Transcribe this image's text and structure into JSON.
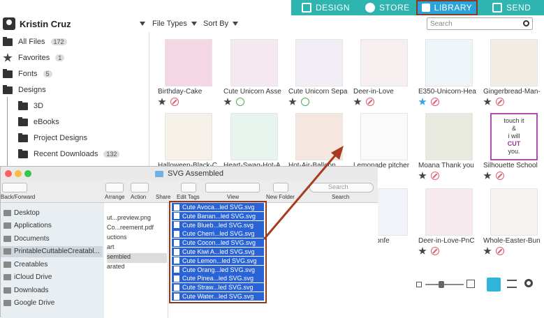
{
  "nav": {
    "design": "DESIGN",
    "store": "STORE",
    "library": "LIBRARY",
    "send": "SEND"
  },
  "user": {
    "name": "Kristin Cruz"
  },
  "toolbar": {
    "file_types": "File Types",
    "sort_by": "Sort By",
    "search_placeholder": "Search"
  },
  "sidebar": {
    "all_files": "All Files",
    "all_files_count": "172",
    "favorites": "Favorites",
    "favorites_count": "1",
    "fonts": "Fonts",
    "fonts_count": "5",
    "designs": "Designs",
    "f3d": "3D",
    "ebooks": "eBooks",
    "project_designs": "Project Designs",
    "recent_downloads": "Recent Downloads",
    "recent_count": "132"
  },
  "cards": [
    {
      "label": "Birthday-Cake"
    },
    {
      "label": "Cute Unicorn Asse"
    },
    {
      "label": "Cute Unicorn Sepa"
    },
    {
      "label": "Deer-in-Love"
    },
    {
      "label": "E350-Unicorn-Hea"
    },
    {
      "label": "Gingerbread-Man-"
    },
    {
      "label": "Halloween-Black-C"
    },
    {
      "label": "Heart-Swag-Hot-A"
    },
    {
      "label": "Hot-Air-Balloon"
    },
    {
      "label": "Lemonade pitcher"
    },
    {
      "label": "Moana Thank you"
    },
    {
      "label": "Silhouette School"
    },
    {
      "label": "nday-Confe"
    },
    {
      "label": "Deer-in-Love-PnC"
    },
    {
      "label": "Whole-Easter-Bun"
    }
  ],
  "sticker": {
    "line1": "touch it",
    "line2": "&",
    "line3": "i will",
    "line4": "CUT",
    "line5": "you."
  },
  "finder": {
    "title": "SVG Assembled",
    "back_forward": "Back/Forward",
    "arrange": "Arrange",
    "action": "Action",
    "share": "Share",
    "edit_tags": "Edit Tags",
    "view": "View",
    "new_folder": "New Folder",
    "search": "Search",
    "search_placeholder": "Search",
    "sidebar": [
      "Desktop",
      "Applications",
      "Documents",
      "PrintableCuttableCreatabl...",
      "Creatables",
      "iCloud Drive",
      "Downloads",
      "Google Drive"
    ],
    "column": [
      "ut...preview.png",
      "Co...reement.pdf",
      "uctions",
      "art",
      "sembled",
      "arated"
    ],
    "files": [
      "Cute Avoca...led SVG.svg",
      "Cute Banan...led SVG.svg",
      "Cute Blueb...led SVG.svg",
      "Cute Cherri...led SVG.svg",
      "Cute Cocon...led SVG.svg",
      "Cute Kiwi A...led SVG.svg",
      "Cute Lemon...led SVG.svg",
      "Cute Orang...led SVG.svg",
      "Cute Pinea...led SVG.svg",
      "Cute Straw...led SVG.svg",
      "Cute Water...led SVG.svg"
    ]
  },
  "colors": {
    "teal": "#2fb5b0",
    "library_blue": "#2aa3d9",
    "highlight_border": "#8b3a1f",
    "selection_blue": "#2a63d6"
  }
}
